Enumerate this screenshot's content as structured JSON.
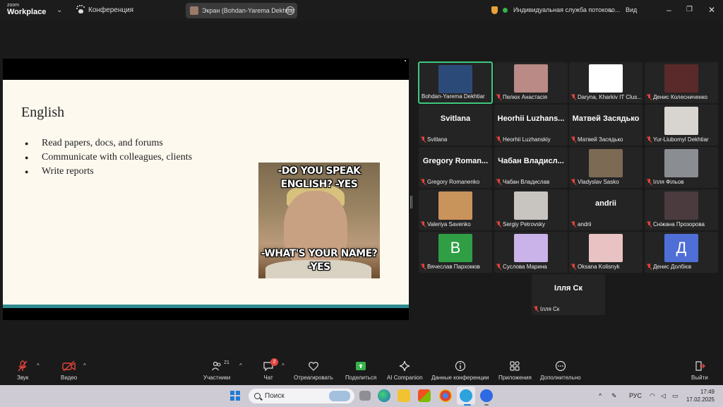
{
  "titlebar": {
    "logo_top": "zoom",
    "logo_bottom": "Workplace",
    "conference_label": "Конференция",
    "screen_tab_label": "Экран (Bohdan-Yarema Dekhtiar",
    "service_label": "Индивидуальная служба потоково...",
    "view_label": "Вид"
  },
  "slide": {
    "title": "English",
    "bullets": [
      "Read papers, docs, and forums",
      "Communicate with colleagues, clients",
      "Write reports"
    ],
    "meme_top": "-DO YOU SPEAK ENGLISH? -YES",
    "meme_bottom": "-WHAT'S YOUR NAME? -YES"
  },
  "participants": [
    {
      "name": "Bohdan-Yarema Dekhtiar",
      "muted": false,
      "active": true,
      "pic_color": "#2c4a78"
    },
    {
      "name": "Пелюх Анастасія",
      "muted": true,
      "pic_color": "#b98a86"
    },
    {
      "name": "Daryna, Kharkiv IT Clus...",
      "muted": true,
      "pic_color": "#ffffff"
    },
    {
      "name": "Денис Колесниченко",
      "muted": true,
      "pic_color": "#5a2a2a"
    },
    {
      "name": "Svitlana",
      "muted": true,
      "big": "Svitlana"
    },
    {
      "name": "Heorhii Luzhanskiy",
      "muted": true,
      "big": "Heorhii Luzhans..."
    },
    {
      "name": "Матвей Засядько",
      "muted": true,
      "big": "Матвей Засядько"
    },
    {
      "name": "Yur-Liubomyl Dekhtiar",
      "muted": true,
      "pic_color": "#d8d4cf"
    },
    {
      "name": "Gregory Romanenko",
      "muted": true,
      "big": "Gregory Roman..."
    },
    {
      "name": "Чабан Владислав",
      "muted": true,
      "big": "Чабан Владисл..."
    },
    {
      "name": "Vladyslav Sasko",
      "muted": true,
      "pic_color": "#7c6a55"
    },
    {
      "name": "Ілля Фільов",
      "muted": true,
      "pic_color": "#8a8d92"
    },
    {
      "name": "Valeriya Savenko",
      "muted": true,
      "pic_color": "#c9935c"
    },
    {
      "name": "Sergiy Petrovsky",
      "muted": true,
      "pic_color": "#c8c5c0"
    },
    {
      "name": "andrii",
      "muted": true,
      "big": "andrii"
    },
    {
      "name": "Сніжана Прозорова",
      "muted": true,
      "pic_color": "#4b3b3f"
    },
    {
      "name": "Вячеслав Пархомов",
      "muted": true,
      "letter": "B",
      "pic_color": "#2f9e44"
    },
    {
      "name": "Суслова Марина",
      "muted": true,
      "pic_color": "#c9b3e8"
    },
    {
      "name": "Oksana Kolisnyk",
      "muted": true,
      "pic_color": "#e9c3c3"
    },
    {
      "name": "Денис Долбієв",
      "muted": true,
      "letter": "Д",
      "pic_color": "#4f6fd6"
    },
    {
      "name": "Ілля Ск",
      "muted": true,
      "big": "Ілля Ск"
    }
  ],
  "toolbar": {
    "audio": "Звук",
    "video": "Видео",
    "participants": "Участники",
    "participants_count": "21",
    "chat": "Чат",
    "chat_badge": "2",
    "react": "Отреагировать",
    "share": "Поделиться",
    "ai": "AI Companion",
    "info": "Данные конференции",
    "apps": "Приложения",
    "more": "Дополнительно",
    "leave": "Выйти"
  },
  "taskbar": {
    "search_placeholder": "Поиск",
    "lang": "РУС",
    "time": "17:49",
    "date": "17.02.2025"
  },
  "colors": {
    "active_border": "#3cc97e",
    "muted_red": "#e0443c",
    "slide_accent": "#2e8b8f"
  }
}
